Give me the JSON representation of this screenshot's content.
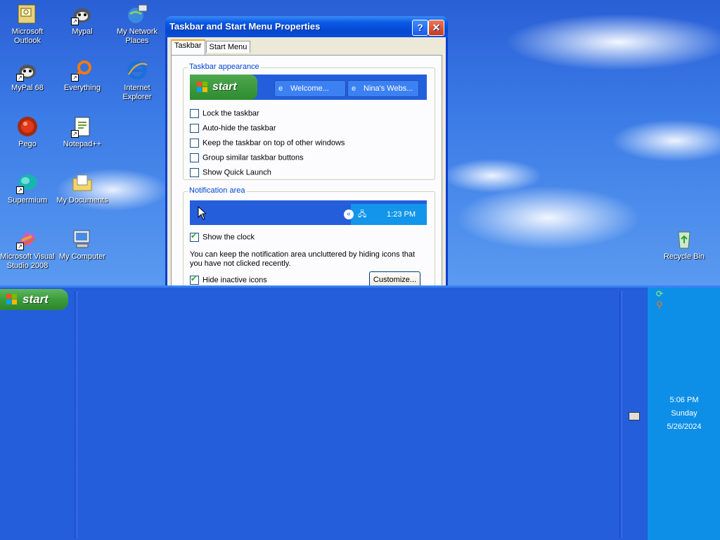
{
  "desktop": {
    "icons": [
      {
        "label": "Microsoft Outlook",
        "icon": "outlook-icon"
      },
      {
        "label": "Mypal",
        "icon": "mypal-icon"
      },
      {
        "label": "My Network Places",
        "icon": "network-places-icon"
      },
      {
        "label": "MyPal 68",
        "icon": "mypal68-icon"
      },
      {
        "label": "Everything",
        "icon": "everything-icon"
      },
      {
        "label": "Internet Explorer",
        "icon": "internet-explorer-icon"
      },
      {
        "label": "Pego",
        "icon": "pego-icon"
      },
      {
        "label": "Notepad++",
        "icon": "notepadpp-icon"
      },
      {
        "label": "Supermium",
        "icon": "supermium-icon"
      },
      {
        "label": "My Documents",
        "icon": "my-documents-icon"
      },
      {
        "label": "Microsoft Visual Studio 2008",
        "icon": "visual-studio-icon"
      },
      {
        "label": "My Computer",
        "icon": "my-computer-icon"
      },
      {
        "label": "Recycle Bin",
        "icon": "recycle-bin-icon"
      }
    ]
  },
  "dialog": {
    "title": "Taskbar and Start Menu Properties",
    "help_button": "?",
    "close_button": "✕",
    "tabs": [
      {
        "label": "Taskbar",
        "active": true
      },
      {
        "label": "Start Menu",
        "active": false
      }
    ],
    "taskbar_appearance": {
      "label": "Taskbar appearance",
      "preview": {
        "start_label": "start",
        "tasks": [
          "Welcome...",
          "Nina's Webs..."
        ]
      },
      "options": [
        {
          "label": "Lock the taskbar",
          "checked": false
        },
        {
          "label": "Auto-hide the taskbar",
          "checked": false
        },
        {
          "label": "Keep the taskbar on top of other windows",
          "checked": false
        },
        {
          "label": "Group similar taskbar buttons",
          "checked": false
        },
        {
          "label": "Show Quick Launch",
          "checked": false
        }
      ]
    },
    "notification_area": {
      "label": "Notification area",
      "preview_time": "1:23 PM",
      "show_clock": {
        "label": "Show the clock",
        "checked": true
      },
      "description": "You can keep the notification area uncluttered by hiding icons that you have not clicked recently.",
      "hide_inactive": {
        "label": "Hide inactive icons",
        "checked": true
      },
      "customize_button": "Customize..."
    }
  },
  "taskbar": {
    "start_label": "start",
    "clock": {
      "time": "5:06 PM",
      "day": "Sunday",
      "date": "5/26/2024"
    }
  },
  "colors": {
    "taskbar_blue": "#245edb",
    "tray_blue": "#0d8fe8",
    "start_green": "#3b9c3b",
    "dialog_face": "#ece9d8",
    "group_label_blue": "#0046d5"
  }
}
